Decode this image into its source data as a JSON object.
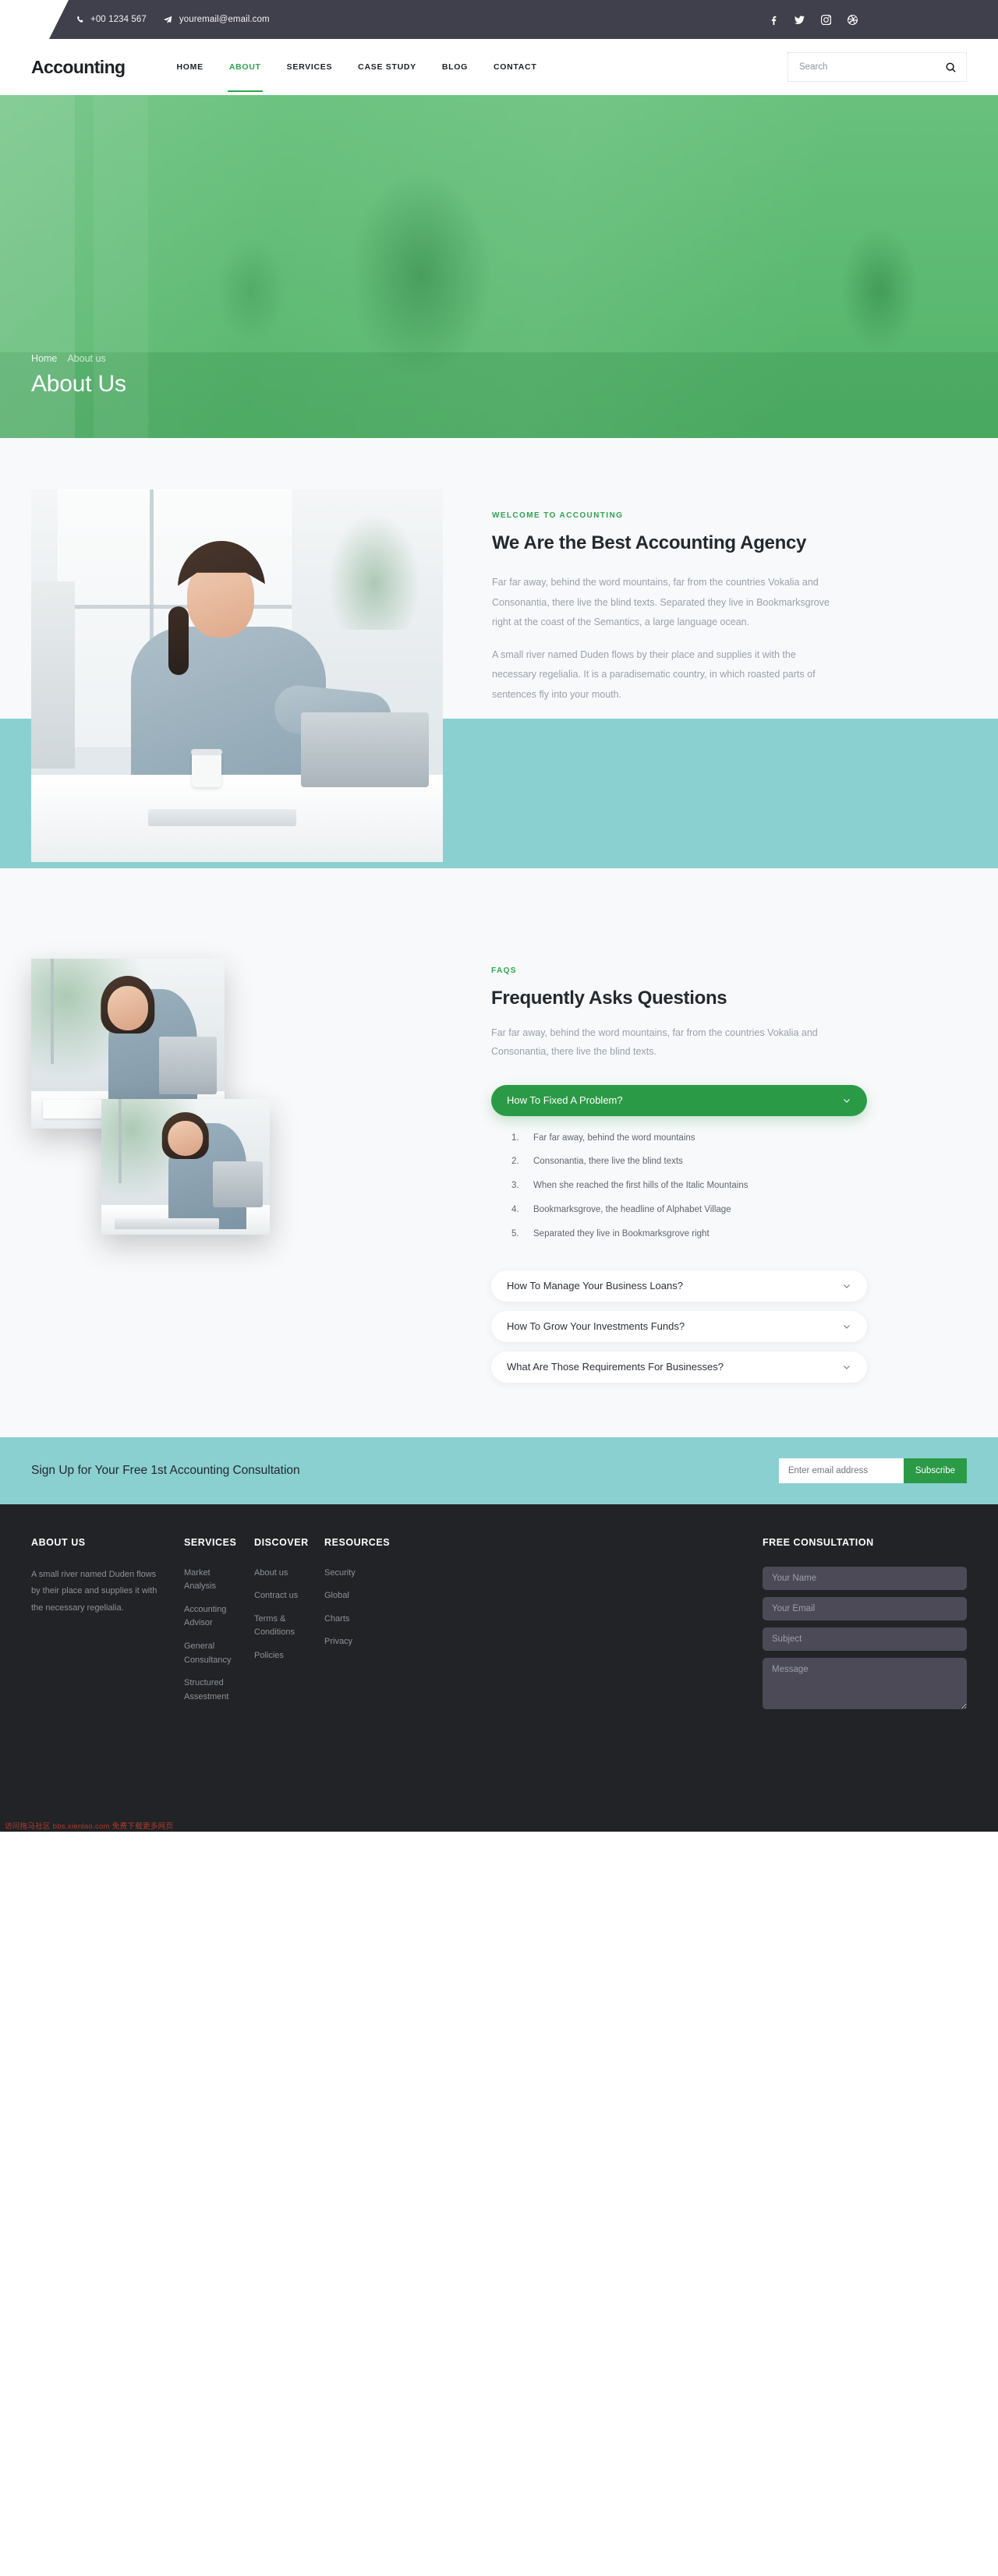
{
  "topbar": {
    "phone": "+00 1234 567",
    "email": "youremail@email.com",
    "phone_icon": "phone-icon",
    "email_icon": "paper-plane-icon",
    "social": [
      {
        "name": "facebook-icon",
        "label": "Facebook"
      },
      {
        "name": "twitter-icon",
        "label": "Twitter"
      },
      {
        "name": "instagram-icon",
        "label": "Instagram"
      },
      {
        "name": "dribbble-icon",
        "label": "Dribbble"
      }
    ]
  },
  "nav": {
    "logo": "Accounting",
    "links": [
      {
        "label": "HOME",
        "active": false
      },
      {
        "label": "ABOUT",
        "active": true
      },
      {
        "label": "SERVICES",
        "active": false
      },
      {
        "label": "CASE STUDY",
        "active": false
      },
      {
        "label": "BLOG",
        "active": false
      },
      {
        "label": "CONTACT",
        "active": false
      }
    ],
    "search_placeholder": "Search",
    "search_value": ""
  },
  "hero": {
    "breadcrumb_home": "Home",
    "breadcrumb_current": "About us",
    "title": "About Us"
  },
  "about": {
    "eyebrow": "WELCOME TO ACCOUNTING",
    "title": "We Are the Best Accounting Agency",
    "paragraph_1": "Far far away, behind the word mountains, far from the countries Vokalia and Consonantia, there live the blind texts. Separated they live in Bookmarksgrove right at the coast of the Semantics, a large language ocean.",
    "paragraph_2": "A small river named Duden flows by their place and supplies it with the necessary regelialia. It is a paradisematic country, in which roasted parts of sentences fly into your mouth."
  },
  "faq": {
    "eyebrow": "FAQS",
    "title": "Frequently Asks Questions",
    "lead": "Far far away, behind the word mountains, far from the countries Vokalia and Consonantia, there live the blind texts.",
    "items": [
      {
        "question": "How To Fixed A Problem?",
        "open": true,
        "answers": [
          "Far far away, behind the word mountains",
          "Consonantia, there live the blind texts",
          "When she reached the first hills of the Italic Mountains",
          "Bookmarksgrove, the headline of Alphabet Village",
          "Separated they live in Bookmarksgrove right"
        ]
      },
      {
        "question": "How To Manage Your Business Loans?",
        "open": false,
        "answers": []
      },
      {
        "question": "How To Grow Your Investments Funds?",
        "open": false,
        "answers": []
      },
      {
        "question": "What Are Those Requirements For Businesses?",
        "open": false,
        "answers": []
      }
    ]
  },
  "cta": {
    "title": "Sign Up for Your Free 1st Accounting Consultation",
    "input_placeholder": "Enter email address",
    "input_value": "",
    "button": "Subscribe"
  },
  "footer": {
    "about": {
      "heading": "ABOUT US",
      "text": "A small river named Duden flows by their place and supplies it with the necessary regelialia."
    },
    "services": {
      "heading": "SERVICES",
      "links": [
        "Market Analysis",
        "Accounting Advisor",
        "General Consultancy",
        "Structured Assestment"
      ]
    },
    "discover": {
      "heading": "DISCOVER",
      "links": [
        "About us",
        "Contract us",
        "Terms & Conditions",
        "Policies"
      ]
    },
    "resources": {
      "heading": "RESOURCES",
      "links": [
        "Security",
        "Global",
        "Charts",
        "Privacy"
      ]
    },
    "consultation": {
      "heading": "FREE CONSULTATION",
      "name_placeholder": "Your Name",
      "email_placeholder": "Your Email",
      "subject_placeholder": "Subject",
      "message_placeholder": "Message"
    }
  },
  "watermark": "访问拖马社区 bbs.xienlao.com 免费下载更多网页",
  "colors": {
    "accent_green": "#2b9a46",
    "nav_active": "#2ea44f",
    "teal": "#8bd0d1",
    "dark": "#403f4c",
    "footer_bg": "#212326"
  }
}
